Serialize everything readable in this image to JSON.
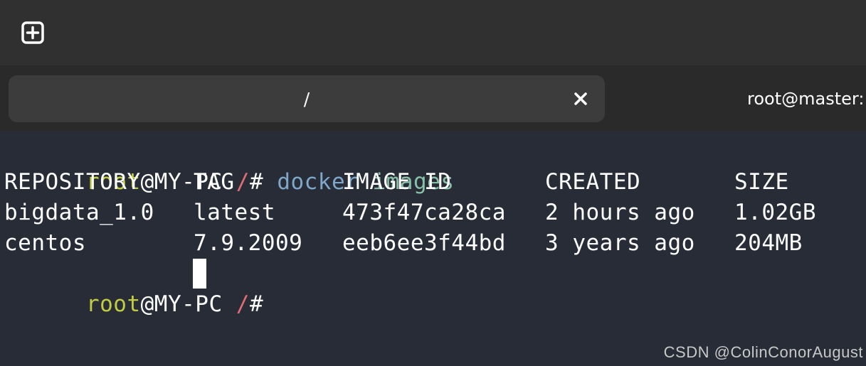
{
  "topbar": {
    "new_tab_icon": "plus-square-icon"
  },
  "tabs": [
    {
      "label": "/",
      "active": true,
      "close_icon": "close-icon"
    },
    {
      "label": "root@master:",
      "active": false
    }
  ],
  "terminal": {
    "prompt": {
      "user": "root",
      "host": "@MY-PC",
      "path": "/",
      "symbol": "#"
    },
    "command": {
      "name": "docker",
      "args": "images"
    },
    "table": {
      "headers": [
        "REPOSITORY",
        "TAG",
        "IMAGE ID",
        "CREATED",
        "SIZE"
      ],
      "rows": [
        [
          "bigdata_1.0",
          "latest",
          "473f47ca28ca",
          "2 hours ago",
          "1.02GB"
        ],
        [
          "centos",
          "7.9.2009",
          "eeb6ee3f44bd",
          "3 years ago",
          "204MB"
        ]
      ]
    }
  },
  "colors": {
    "background": "#272c36",
    "topbar": "#303030",
    "tabbar": "#2a2a2a",
    "active_tab": "#3c3c3c",
    "prompt_user": "#c2cc41",
    "prompt_path": "#e06c75",
    "command": "#7ea7c9",
    "argument": "#88c0a8"
  },
  "watermark": "CSDN @ColinConorAugust"
}
